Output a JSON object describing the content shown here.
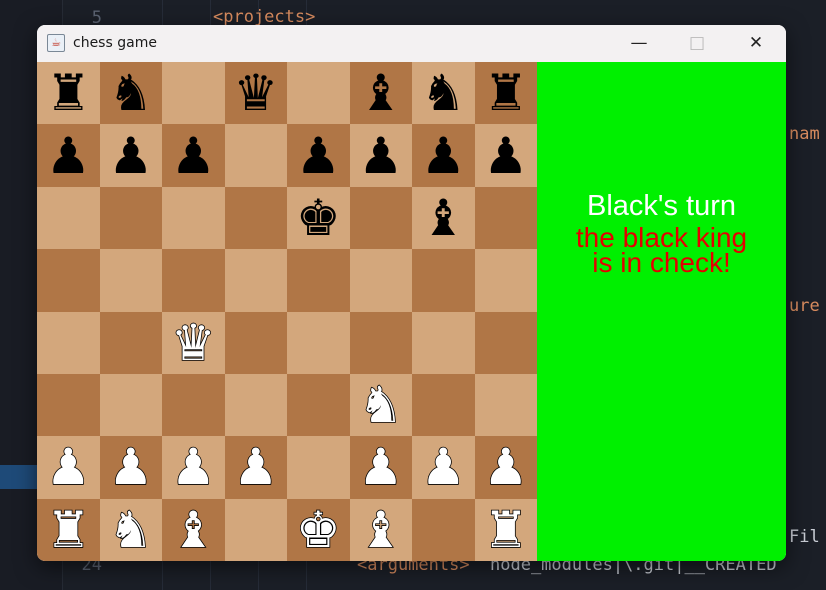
{
  "editor": {
    "line_numbers": [
      "5",
      "24"
    ],
    "lines": {
      "projects": "<projects>",
      "nam": "nam",
      "ure": "ure",
      "fil": "Fil",
      "arguments_tag": "<arguments>",
      "arguments_text": "node_modules|\\.git|__CREATED"
    }
  },
  "window": {
    "title": "chess game",
    "minimize_icon": "minimize-icon",
    "maximize_icon": "maximize-icon",
    "close_icon": "close-icon"
  },
  "board": {
    "light_color": "#d3a77c",
    "dark_color": "#b07646",
    "ranks": [
      [
        "br",
        "bn",
        "",
        "bq",
        "",
        "bb",
        "bn",
        "br"
      ],
      [
        "bp",
        "bp",
        "bp",
        "",
        "bp",
        "bp",
        "bp",
        "bp"
      ],
      [
        "",
        "",
        "",
        "",
        "bk",
        "",
        "bb",
        ""
      ],
      [
        "",
        "",
        "",
        "",
        "",
        "",
        "",
        ""
      ],
      [
        "",
        "",
        "wq",
        "",
        "",
        "",
        "",
        ""
      ],
      [
        "",
        "",
        "",
        "",
        "",
        "wn",
        "",
        ""
      ],
      [
        "wp",
        "wp",
        "wp",
        "wp",
        "",
        "wp",
        "wp",
        "wp"
      ],
      [
        "wr",
        "wn",
        "wb",
        "",
        "wk",
        "wb",
        "",
        "wr"
      ]
    ]
  },
  "panel": {
    "background": "#00f000",
    "turn_text": "Black's turn",
    "check_line1": "the black king",
    "check_line2": "is in check!",
    "check_color": "#e40000"
  }
}
